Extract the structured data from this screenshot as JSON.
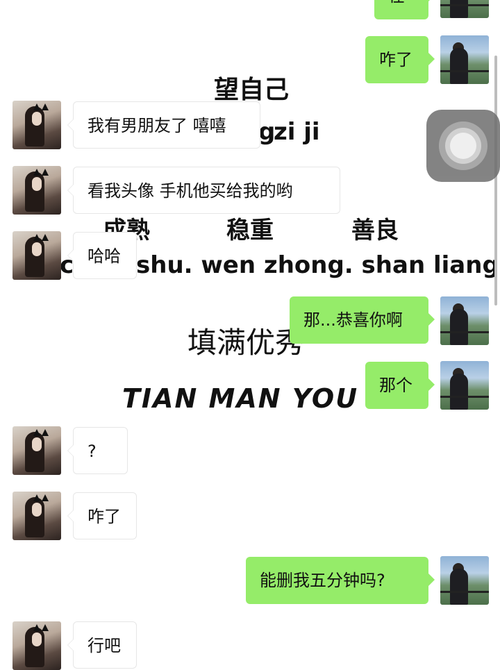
{
  "background_text": {
    "line1": "望自己",
    "line2": "zi ji",
    "line2_prefix": "g",
    "row_cn_1": "成熟",
    "row_cn_2": "稳重",
    "row_cn_3": "善良",
    "pinyin_left": "ch",
    "pinyin_mid": "shu.  wen zhong.  shan liang",
    "fill_cn": "填满优秀",
    "fill_pinyin": "TIAN  MAN YOU XI"
  },
  "messages": [
    {
      "side": "right",
      "text": "在"
    },
    {
      "side": "right",
      "text": "咋了"
    },
    {
      "side": "left",
      "text": "我有男朋友了 嘻嘻"
    },
    {
      "side": "left",
      "text": "看我头像 手机他买给我的哟"
    },
    {
      "side": "left",
      "text": "哈哈"
    },
    {
      "side": "right",
      "text": "那...恭喜你啊"
    },
    {
      "side": "right",
      "text": "那个"
    },
    {
      "side": "left",
      "text": "?"
    },
    {
      "side": "left",
      "text": "咋了"
    },
    {
      "side": "right",
      "text": "能删我五分钟吗?"
    },
    {
      "side": "left",
      "text": "行吧"
    }
  ],
  "colors": {
    "right_bubble": "#95ec69",
    "left_bubble": "#ffffff",
    "background": "#ffffff"
  },
  "icons": {
    "assistive_touch": "assistive-touch-icon"
  }
}
